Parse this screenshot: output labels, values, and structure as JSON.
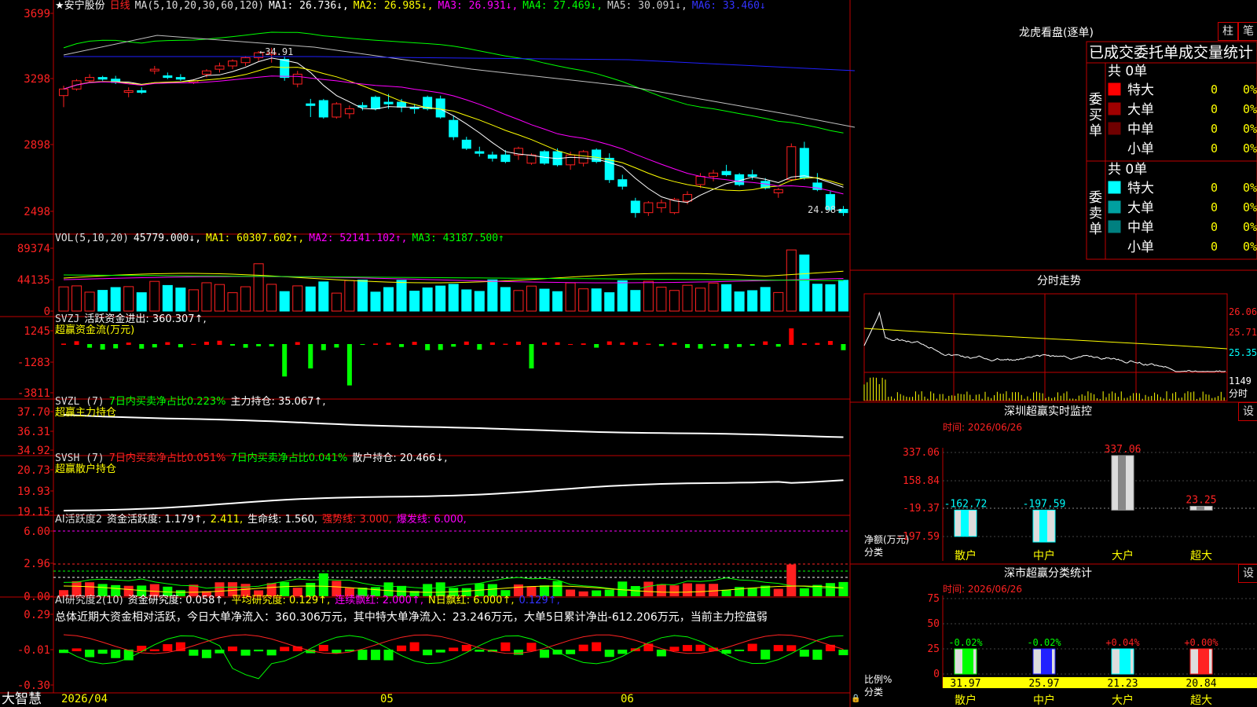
{
  "colors": {
    "up": "#ff2020",
    "down": "#00ffff",
    "border": "#c00000",
    "ma1": "#ffffff",
    "ma2": "#ffff00",
    "ma3": "#ff00ff",
    "ma4": "#00ff00",
    "ma5": "#c0c0c0",
    "ma6": "#2020ff"
  },
  "main": {
    "stock_name": "★安宁股份",
    "period": "日线",
    "ma_label": "MA(5,10,20,30,60,120)",
    "ma1": "MA1: 26.736↓,",
    "ma2": "MA2: 26.985↓,",
    "ma3": "MA3: 26.931↓,",
    "ma4": "MA4: 27.469↓,",
    "ma5": "MA5: 30.091↓,",
    "ma6": "MA6: 33.460↓",
    "y_ticks": [
      "3699",
      "3298",
      "2898",
      "2498"
    ],
    "high_label": "34.91",
    "low_label": "24.98"
  },
  "vol": {
    "label": "VOL(5,10,20)",
    "value": "45779.000↓,",
    "ma1": "MA1: 60307.602↑,",
    "ma2": "MA2: 52141.102↑,",
    "ma3": "MA3: 43187.500↑",
    "y_ticks": [
      "89374",
      "44135",
      "0"
    ]
  },
  "svzj": {
    "label": "SVZJ",
    "title": "活跃资金进出: 360.307↑,",
    "sub": "超赢资金流(万元)",
    "y_ticks": [
      "1245",
      "-1283",
      "-3811"
    ]
  },
  "svzl": {
    "label": "SVZL (7)",
    "p1": "7日内买卖净占比0.223%",
    "p2": "主力持仓: 35.067↑,",
    "sub": "超赢主力持仓",
    "y_ticks": [
      "37.70",
      "36.31",
      "34.92"
    ]
  },
  "svsh": {
    "label": "SVSH (7)",
    "p1": "7日内买卖净占比0.051%",
    "p2": "7日内买卖净占比0.041%",
    "p3": "散户持仓: 20.466↓,",
    "sub": "超赢散户持仓",
    "y_ticks": [
      "20.73",
      "19.93",
      "19.15"
    ]
  },
  "ai1": {
    "label": "AI活跃度2",
    "p1": "资金活跃度: 1.179↑,",
    "p2": "2.411,",
    "p3": "生命线: 1.560,",
    "p4": "强势线: 3.000,",
    "p5": "爆发线: 6.000,",
    "y_ticks": [
      "6.00",
      "2.96",
      "0.00"
    ]
  },
  "ai2": {
    "label": "AI研究度2(10)",
    "p1": "资金研究度: 0.058↑,",
    "p2": "平均研究度: 0.129↑,",
    "p3": "连续飘红: 2.000↑,",
    "p4": "N日飘红: 6.000↑,",
    "p5": "0.129↑,",
    "summary": "总体近期大资金相对活跃，今日大单净流入：360.306万元，其中特大单净流入：23.246万元，大单5日累计净出-612.206万元，当前主力控盘弱",
    "y_ticks": [
      "0.29",
      "-0.01",
      "-0.30"
    ]
  },
  "xaxis": {
    "logo": "大智慧",
    "d1": "2026/04",
    "d2": "05",
    "d3": "06"
  },
  "right": {
    "lhb_title": "龙虎看盘(逐单)",
    "btn_zhu": "柱",
    "btn_bi": "笔",
    "stat_title": "已成交委托单成交量统计",
    "buy_side": "委买单",
    "buy_total": "共 0单",
    "buy_rows": [
      {
        "name": "特大",
        "v": "0",
        "p": "0%",
        "c": "#ff0000"
      },
      {
        "name": "大单",
        "v": "0",
        "p": "0%",
        "c": "#a00000"
      },
      {
        "name": "中单",
        "v": "0",
        "p": "0%",
        "c": "#700000"
      },
      {
        "name": "小单",
        "v": "0",
        "p": "0%",
        "c": "#000000"
      }
    ],
    "sell_side": "委卖单",
    "sell_total": "共 0单",
    "sell_rows": [
      {
        "name": "特大",
        "v": "0",
        "p": "0%",
        "c": "#00ffff"
      },
      {
        "name": "大单",
        "v": "0",
        "p": "0%",
        "c": "#00a0a0"
      },
      {
        "name": "中单",
        "v": "0",
        "p": "0%",
        "c": "#008080"
      },
      {
        "name": "小单",
        "v": "0",
        "p": "0%",
        "c": "#000000"
      }
    ],
    "fs_title": "分时走势",
    "fs_ticks": [
      "26.06",
      "25.71",
      "25.35",
      "1149"
    ],
    "fs_unit": "分时",
    "mon_title": "深圳超赢实时监控",
    "mon_btn": "设",
    "mon_time": "时间: 2026/06/26",
    "mon_ticks": [
      "337.06",
      "158.84",
      "-19.37",
      "-197.59"
    ],
    "mon_ylabel": "净额(万元)",
    "mon_xlabel": "分类",
    "cls_title": "深市超赢分类统计",
    "cls_btn": "设",
    "cls_time": "时间: 2026/06/26",
    "cls_ticks": [
      "75",
      "50",
      "25",
      "0"
    ],
    "cls_ylabel": "比例%",
    "cls_xlabel": "分类"
  },
  "chart_data": [
    {
      "type": "bar",
      "title": "深圳超赢实时监控",
      "categories": [
        "散户",
        "中户",
        "大户",
        "超大"
      ],
      "values": [
        -162.72,
        -197.59,
        337.06,
        23.25
      ],
      "ylim": [
        -197.59,
        337.06
      ],
      "ylabel": "净额(万元)"
    },
    {
      "type": "bar",
      "title": "深市超赢分类统计",
      "categories": [
        "散户",
        "中户",
        "大户",
        "超大"
      ],
      "values": [
        31.97,
        25.97,
        21.23,
        20.84
      ],
      "changes": [
        "-0.02%",
        "-0.02%",
        "+0.04%",
        "+0.00%"
      ],
      "ylim": [
        0,
        75
      ],
      "ylabel": "比例%"
    },
    {
      "type": "candlestick",
      "title": "安宁股份 日线",
      "candles": [
        [
          32.0,
          32.6,
          31.3,
          32.4
        ],
        [
          32.4,
          33.0,
          32.3,
          32.9
        ],
        [
          32.9,
          33.3,
          32.8,
          33.1
        ],
        [
          33.1,
          33.2,
          32.9,
          33.0
        ],
        [
          33.0,
          33.2,
          32.7,
          32.8
        ],
        [
          32.2,
          32.5,
          31.9,
          32.3
        ],
        [
          32.3,
          32.5,
          32.1,
          32.2
        ],
        [
          33.5,
          33.8,
          33.3,
          33.6
        ],
        [
          33.2,
          33.4,
          33.0,
          33.1
        ],
        [
          33.1,
          33.3,
          32.9,
          33.0
        ],
        [
          32.8,
          33.0,
          32.7,
          32.9
        ],
        [
          33.3,
          33.6,
          33.1,
          33.5
        ],
        [
          33.6,
          34.0,
          33.4,
          33.8
        ],
        [
          33.8,
          34.2,
          33.6,
          34.1
        ],
        [
          34.0,
          34.4,
          33.8,
          34.3
        ],
        [
          34.3,
          34.7,
          34.1,
          34.6
        ],
        [
          34.5,
          34.9,
          34.0,
          34.6
        ],
        [
          34.2,
          34.4,
          32.9,
          33.1
        ],
        [
          32.7,
          33.5,
          32.5,
          33.3
        ],
        [
          31.5,
          31.8,
          30.7,
          31.4
        ],
        [
          31.7,
          31.8,
          30.6,
          30.7
        ],
        [
          30.7,
          31.6,
          30.6,
          31.5
        ],
        [
          30.9,
          31.4,
          30.6,
          31.2
        ],
        [
          31.4,
          31.6,
          31.1,
          31.3
        ],
        [
          31.9,
          32.0,
          31.1,
          31.2
        ],
        [
          31.6,
          32.1,
          31.2,
          31.5
        ],
        [
          31.6,
          31.8,
          31.0,
          31.3
        ],
        [
          31.3,
          31.5,
          30.9,
          31.2
        ],
        [
          31.9,
          32.0,
          31.1,
          31.2
        ],
        [
          31.8,
          32.0,
          30.6,
          30.7
        ],
        [
          30.5,
          30.8,
          29.3,
          29.5
        ],
        [
          29.3,
          29.5,
          28.7,
          28.8
        ],
        [
          28.6,
          28.9,
          28.3,
          28.5
        ],
        [
          28.4,
          28.6,
          28.0,
          28.2
        ],
        [
          28.4,
          28.7,
          27.9,
          28.0
        ],
        [
          28.4,
          28.9,
          28.1,
          28.8
        ],
        [
          27.9,
          28.5,
          27.8,
          28.4
        ],
        [
          28.6,
          28.7,
          27.8,
          27.9
        ],
        [
          28.6,
          28.8,
          27.7,
          27.8
        ],
        [
          27.8,
          28.6,
          27.5,
          28.4
        ],
        [
          27.9,
          28.7,
          27.7,
          28.6
        ],
        [
          28.7,
          28.8,
          27.9,
          28.0
        ],
        [
          28.2,
          28.5,
          26.7,
          26.9
        ],
        [
          26.9,
          27.2,
          26.3,
          26.5
        ],
        [
          25.6,
          25.8,
          24.6,
          24.9
        ],
        [
          24.9,
          25.6,
          24.7,
          25.5
        ],
        [
          25.2,
          25.7,
          24.9,
          25.5
        ],
        [
          24.9,
          25.8,
          24.8,
          25.7
        ],
        [
          25.6,
          26.2,
          25.4,
          26.0
        ],
        [
          26.6,
          27.3,
          26.4,
          27.1
        ],
        [
          27.1,
          27.5,
          26.8,
          27.3
        ],
        [
          27.4,
          27.8,
          27.1,
          27.2
        ],
        [
          27.2,
          27.3,
          26.5,
          26.6
        ],
        [
          27.2,
          27.5,
          26.9,
          27.1
        ],
        [
          26.8,
          27.0,
          26.3,
          26.4
        ],
        [
          26.1,
          26.4,
          25.8,
          26.3
        ],
        [
          26.9,
          29.1,
          26.8,
          28.9
        ],
        [
          28.8,
          29.2,
          26.9,
          27.0
        ],
        [
          26.7,
          27.3,
          26.2,
          26.3
        ],
        [
          26.0,
          26.2,
          25.0,
          25.1
        ],
        [
          25.1,
          25.3,
          24.7,
          24.9
        ]
      ]
    }
  ]
}
